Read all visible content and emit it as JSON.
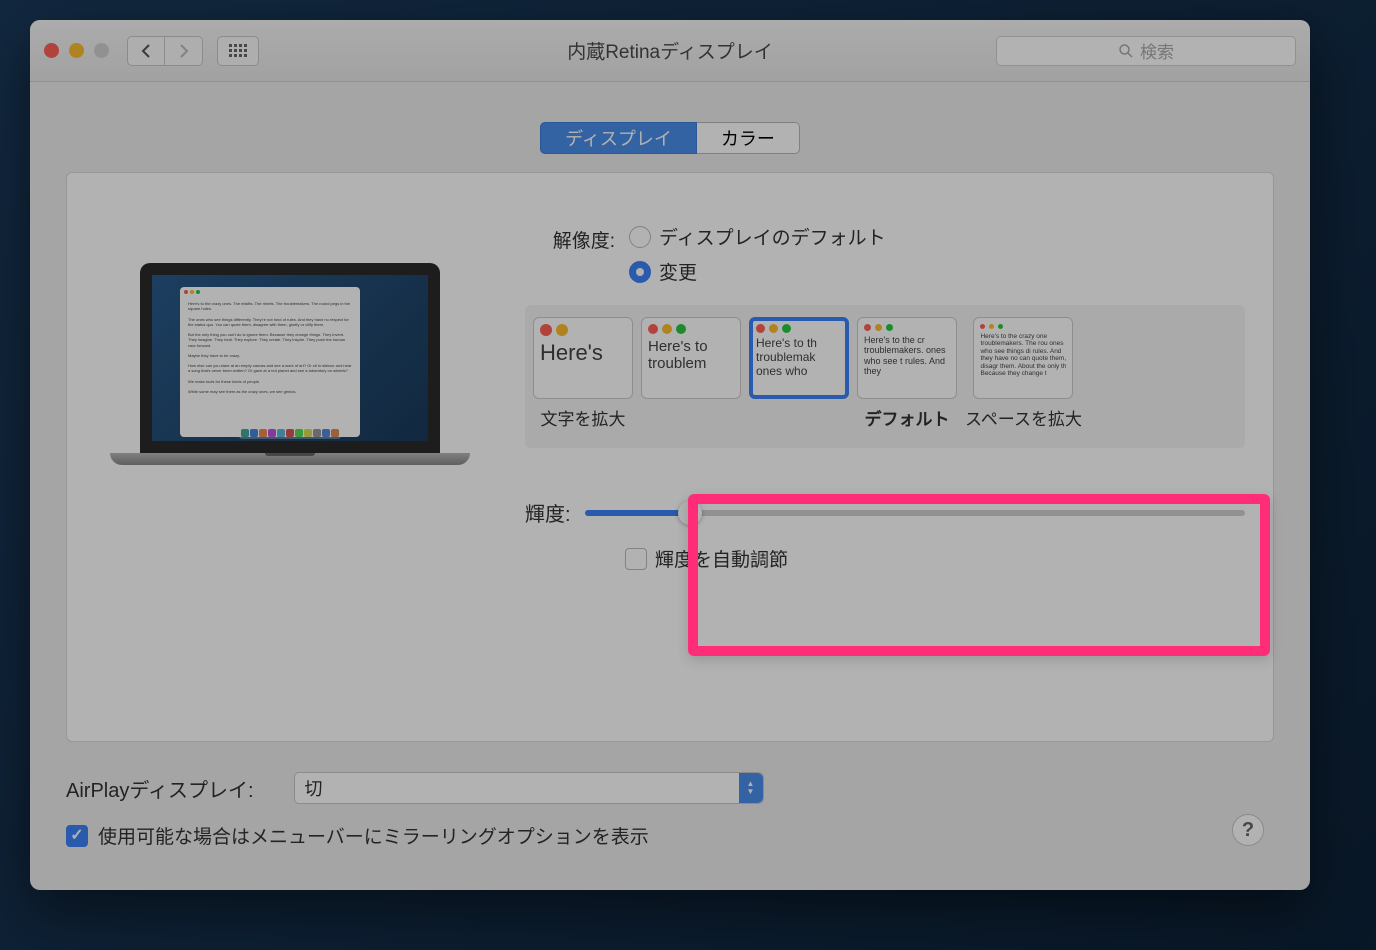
{
  "window": {
    "title": "内蔵Retinaディスプレイ",
    "search_placeholder": "検索"
  },
  "tabs": {
    "display": "ディスプレイ",
    "color": "カラー"
  },
  "resolution": {
    "label": "解像度:",
    "default_option": "ディスプレイのデフォルト",
    "scaled_option": "変更",
    "selected": "scaled"
  },
  "resolution_options": [
    {
      "label": "文字を拡大",
      "sample": "Here's"
    },
    {
      "label": "",
      "sample": "Here's to troublem"
    },
    {
      "label": "",
      "sample": "Here's to th troublemak ones who",
      "selected": true
    },
    {
      "label": "デフォルト",
      "sample": "Here's to the cr troublemakers. ones who see t rules. And they"
    },
    {
      "label": "スペースを拡大",
      "sample": "Here's to the crazy one troublemakers. The rou ones who see things di rules. And they have no can quote them, disagr them. About the only th Because they change t"
    }
  ],
  "brightness": {
    "label": "輝度:",
    "value": 16,
    "auto_label": "輝度を自動調節",
    "auto_checked": false
  },
  "airplay": {
    "label": "AirPlayディスプレイ:",
    "value": "切"
  },
  "mirror": {
    "label": "使用可能な場合はメニューバーにミラーリングオプションを表示",
    "checked": true
  },
  "help": "?"
}
